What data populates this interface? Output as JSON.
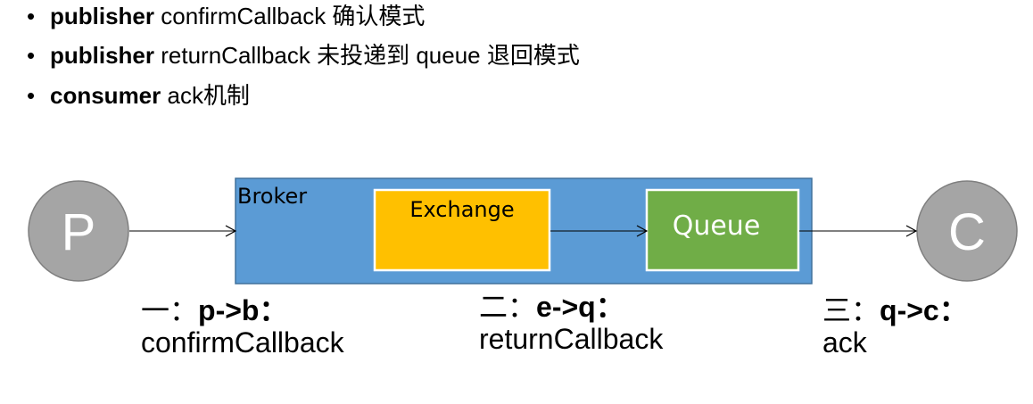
{
  "bullets": [
    {
      "role": "publisher",
      "text": "confirmCallback 确认模式"
    },
    {
      "role": "publisher",
      "text": "returnCallback 未投递到 queue 退回模式"
    },
    {
      "role": "consumer",
      "text": "ack机制"
    }
  ],
  "bullet_symbol": "•",
  "diagram": {
    "producer_label": "P",
    "consumer_label": "C",
    "broker_label": "Broker",
    "exchange_label": "Exchange",
    "queue_label": "Queue"
  },
  "captions": [
    {
      "prefix": "一：",
      "route": "p->b：",
      "callback": "confirmCallback"
    },
    {
      "prefix": "二：",
      "route": "e->q：",
      "callback": "returnCallback"
    },
    {
      "prefix": "三：",
      "route": "q->c：",
      "callback": "ack"
    }
  ],
  "colors": {
    "broker_fill": "#5b9bd5",
    "broker_stroke": "#41719c",
    "exchange_fill": "#ffc000",
    "queue_fill": "#70ad47",
    "node_fill": "#a5a5a5",
    "node_stroke": "#7f7f7f"
  }
}
